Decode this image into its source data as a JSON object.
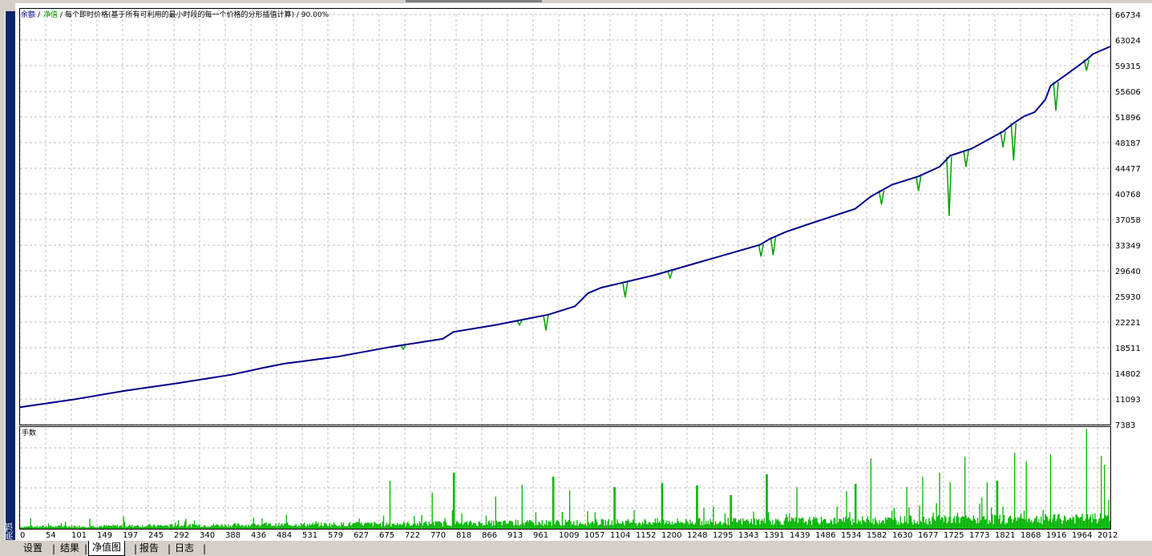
{
  "sidebar": {
    "label": "测试"
  },
  "tabs": [
    {
      "label": "设置",
      "active": false
    },
    {
      "label": "结果",
      "active": false
    },
    {
      "label": "净值图",
      "active": true
    },
    {
      "label": "报告",
      "active": false
    },
    {
      "label": "日志",
      "active": false
    }
  ],
  "colors": {
    "balance": "#00008b",
    "equity": "#00a000",
    "volume": "#00b400",
    "grid": "#c0c0c0"
  },
  "chart_data": [
    {
      "type": "line",
      "legend": {
        "balance": "余额",
        "equity": "净值",
        "rest": "每个即时价格(基于所有可利用的最小时段的每一个价格的分形插值计算) / 90.00%"
      },
      "y_ticks": [
        "66734",
        "63024",
        "59315",
        "55606",
        "51896",
        "48187",
        "44477",
        "40768",
        "37058",
        "33349",
        "29640",
        "25930",
        "22221",
        "18511",
        "14802",
        "11093",
        "7383"
      ],
      "ylim": [
        7383,
        66734
      ],
      "x_ticks": [
        "0",
        "54",
        "101",
        "149",
        "197",
        "245",
        "292",
        "340",
        "388",
        "436",
        "484",
        "531",
        "579",
        "627",
        "675",
        "722",
        "770",
        "818",
        "866",
        "913",
        "961",
        "1009",
        "1057",
        "1104",
        "1152",
        "1200",
        "1248",
        "1295",
        "1343",
        "1391",
        "1439",
        "1486",
        "1534",
        "1582",
        "1630",
        "1677",
        "1725",
        "1773",
        "1821",
        "1868",
        "1916",
        "1964",
        "2012"
      ],
      "xlim": [
        0,
        2063
      ],
      "series": [
        {
          "name": "余额",
          "points": [
            [
              0,
              9900
            ],
            [
              100,
              11000
            ],
            [
              200,
              12300
            ],
            [
              300,
              13400
            ],
            [
              400,
              14600
            ],
            [
              460,
              15600
            ],
            [
              500,
              16200
            ],
            [
              600,
              17200
            ],
            [
              700,
              18600
            ],
            [
              800,
              19800
            ],
            [
              820,
              20800
            ],
            [
              900,
              21800
            ],
            [
              1000,
              23300
            ],
            [
              1050,
              24500
            ],
            [
              1075,
              26400
            ],
            [
              1100,
              27200
            ],
            [
              1200,
              29000
            ],
            [
              1300,
              31200
            ],
            [
              1400,
              33400
            ],
            [
              1420,
              34300
            ],
            [
              1450,
              35300
            ],
            [
              1500,
              36600
            ],
            [
              1580,
              38600
            ],
            [
              1610,
              40400
            ],
            [
              1650,
              42100
            ],
            [
              1700,
              43300
            ],
            [
              1740,
              44700
            ],
            [
              1760,
              46300
            ],
            [
              1800,
              47300
            ],
            [
              1860,
              49800
            ],
            [
              1880,
              51000
            ],
            [
              1900,
              52000
            ],
            [
              1920,
              52600
            ],
            [
              1940,
              54400
            ],
            [
              1950,
              56400
            ],
            [
              1990,
              58600
            ],
            [
              2020,
              60300
            ],
            [
              2030,
              61000
            ],
            [
              2063,
              62100
            ]
          ]
        },
        {
          "name": "净值",
          "dips": [
            [
              725,
              18300
            ],
            [
              945,
              21800
            ],
            [
              995,
              21000
            ],
            [
              1145,
              25800
            ],
            [
              1230,
              28600
            ],
            [
              1402,
              31700
            ],
            [
              1425,
              31900
            ],
            [
              1630,
              39200
            ],
            [
              1700,
              41200
            ],
            [
              1758,
              37600
            ],
            [
              1790,
              44700
            ],
            [
              1860,
              47500
            ],
            [
              1880,
              45600
            ],
            [
              1960,
              52800
            ],
            [
              2018,
              58600
            ]
          ]
        }
      ]
    },
    {
      "type": "bar",
      "label": "手数",
      "description": "per-trade volume bars along the same 0–2063 trade axis",
      "spikes": [
        [
          700,
          60
        ],
        [
          780,
          45
        ],
        [
          821,
          70
        ],
        [
          900,
          40
        ],
        [
          950,
          55
        ],
        [
          1009,
          65
        ],
        [
          1040,
          48
        ],
        [
          1125,
          52
        ],
        [
          1215,
          57
        ],
        [
          1281,
          54
        ],
        [
          1345,
          42
        ],
        [
          1413,
          68
        ],
        [
          1470,
          52
        ],
        [
          1564,
          47
        ],
        [
          1581,
          56
        ],
        [
          1610,
          88
        ],
        [
          1678,
          52
        ],
        [
          1708,
          65
        ],
        [
          1740,
          70
        ],
        [
          1760,
          58
        ],
        [
          1788,
          90
        ],
        [
          1830,
          58
        ],
        [
          1849,
          60
        ],
        [
          1882,
          95
        ],
        [
          1904,
          84
        ],
        [
          1950,
          93
        ],
        [
          2018,
          125
        ],
        [
          2046,
          91
        ],
        [
          2052,
          80
        ]
      ]
    }
  ]
}
